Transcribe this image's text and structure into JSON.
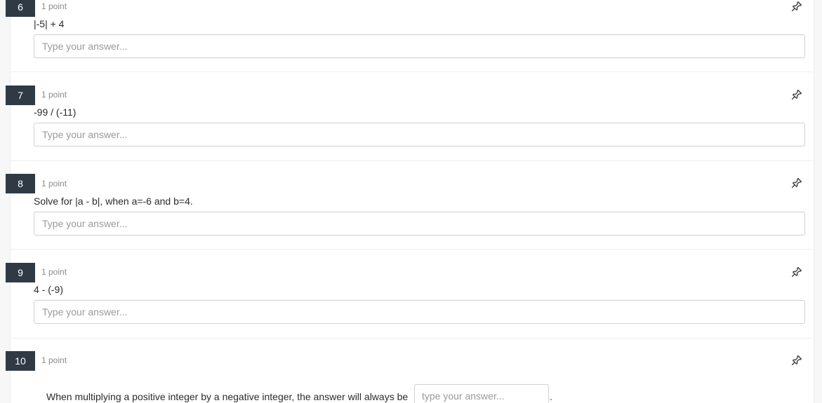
{
  "questions": [
    {
      "number": "6",
      "points": "1 point",
      "prompt": "|-5| + 4",
      "placeholder": "Type your answer..."
    },
    {
      "number": "7",
      "points": "1 point",
      "prompt": "-99 / (-11)",
      "placeholder": "Type your answer..."
    },
    {
      "number": "8",
      "points": "1 point",
      "prompt": "Solve for |a - b|, when a=-6 and b=4.",
      "placeholder": "Type your answer..."
    },
    {
      "number": "9",
      "points": "1 point",
      "prompt": "4 - (-9)",
      "placeholder": "Type your answer..."
    },
    {
      "number": "10",
      "points": "1 point",
      "prompt_before": "When multiplying a positive integer by a negative integer, the answer will always be",
      "placeholder": "type your answer...",
      "prompt_after": "."
    }
  ],
  "icons": {
    "pin": "pin-icon"
  },
  "colors": {
    "number_badge_bg": "#2f3a45",
    "points_text": "#8a8a8a",
    "input_border": "#cfcfcf"
  }
}
